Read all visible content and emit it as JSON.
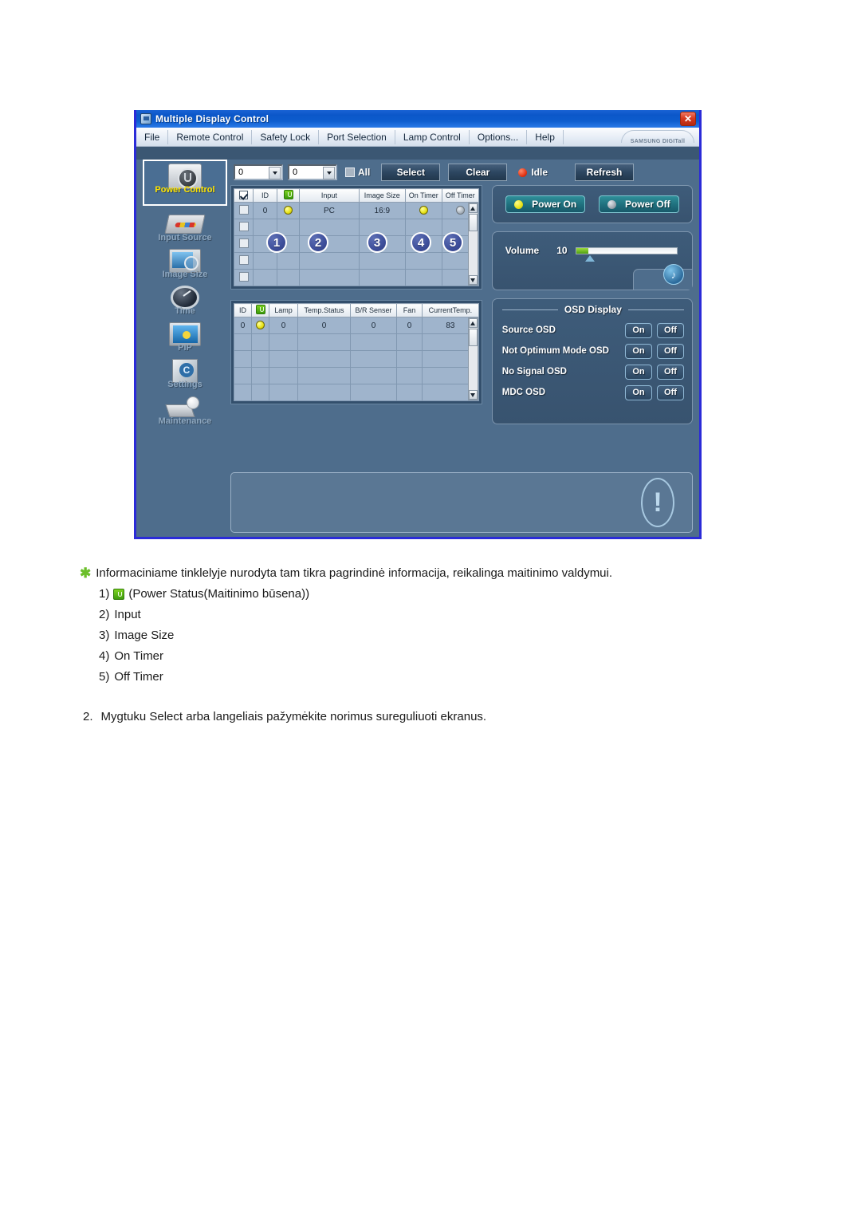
{
  "window": {
    "title": "Multiple Display Control",
    "close_label": "✕",
    "icon": "app-icon",
    "brand": "SAMSUNG DIGITall"
  },
  "menubar": {
    "items": [
      "File",
      "Remote Control",
      "Safety Lock",
      "Port Selection",
      "Lamp Control",
      "Options...",
      "Help"
    ]
  },
  "sidebar": {
    "items": [
      {
        "label": "Power Control",
        "icon": "power-control-icon",
        "active": true
      },
      {
        "label": "Input Source",
        "icon": "input-source-icon",
        "active": false
      },
      {
        "label": "Image Size",
        "icon": "image-size-icon",
        "active": false
      },
      {
        "label": "Time",
        "icon": "clock-icon",
        "active": false
      },
      {
        "label": "PIP",
        "icon": "pip-icon",
        "active": false
      },
      {
        "label": "Settings",
        "icon": "settings-cube-icon",
        "active": false
      },
      {
        "label": "Maintenance",
        "icon": "maintenance-icon",
        "active": false
      }
    ]
  },
  "toolbar": {
    "combo_from": "0",
    "combo_to": "0",
    "all_label": "All",
    "select_label": "Select",
    "clear_label": "Clear",
    "status_label": "Idle",
    "status_color": "#e03010",
    "refresh_label": "Refresh"
  },
  "display_table": {
    "headers": [
      "",
      "ID",
      "",
      "Input",
      "Image Size",
      "On Timer",
      "Off Timer"
    ],
    "power_header_icon": "power-status-icon",
    "check_header_icon": "checkbox-checked-icon",
    "rows": [
      {
        "id": "0",
        "power": "yellow",
        "input": "PC",
        "image_size": "16:9",
        "on_timer": "yellow",
        "off_timer": "gray"
      }
    ],
    "empty_rows": 5
  },
  "lamp_table": {
    "headers": [
      "ID",
      "",
      "Lamp",
      "Temp.Status",
      "B/R Senser",
      "Fan",
      "CurrentTemp."
    ],
    "power_header_icon": "power-status-icon",
    "rows": [
      {
        "id": "0",
        "power": "yellow",
        "lamp": "0",
        "temp_status": "0",
        "br_senser": "0",
        "fan": "0",
        "current_temp": "83"
      }
    ],
    "empty_rows": 5
  },
  "callouts": [
    "1",
    "2",
    "3",
    "4",
    "5"
  ],
  "power_panel": {
    "power_on_label": "Power On",
    "power_off_label": "Power Off",
    "power_on_led": "yellow",
    "power_off_led": "gray"
  },
  "volume_panel": {
    "label": "Volume",
    "value": "10",
    "fill_percent": 11,
    "speaker_icon": "speaker-icon"
  },
  "osd_panel": {
    "title": "OSD Display",
    "rows": [
      {
        "label": "Source OSD",
        "on": "On",
        "off": "Off"
      },
      {
        "label": "Not Optimum Mode OSD",
        "on": "On",
        "off": "Off"
      },
      {
        "label": "No Signal OSD",
        "on": "On",
        "off": "Off"
      },
      {
        "label": "MDC OSD",
        "on": "On",
        "off": "Off"
      }
    ]
  },
  "bottom_bar": {
    "icon": "exclamation-icon",
    "glyph": "!"
  },
  "document": {
    "note": "Informaciniame tinklelyje nurodyta tam tikra pagrindinė informacija, reikalinga maitinimo valdymui.",
    "items": [
      {
        "num": "1)",
        "prefix": "",
        "text": "(Power Status(Maitinimo būsena))",
        "has_icon": true
      },
      {
        "num": "2)",
        "prefix": "",
        "text": "Input",
        "has_icon": false
      },
      {
        "num": "3)",
        "prefix": "",
        "text": "Image Size",
        "has_icon": false
      },
      {
        "num": "4)",
        "prefix": "",
        "text": "On Timer",
        "has_icon": false
      },
      {
        "num": "5)",
        "prefix": "",
        "text": "Off Timer",
        "has_icon": false
      }
    ],
    "step2_num": "2.",
    "step2_text": "Mygtuku Select arba langeliais pažymėkite norimus sureguliuoti ekranus."
  }
}
